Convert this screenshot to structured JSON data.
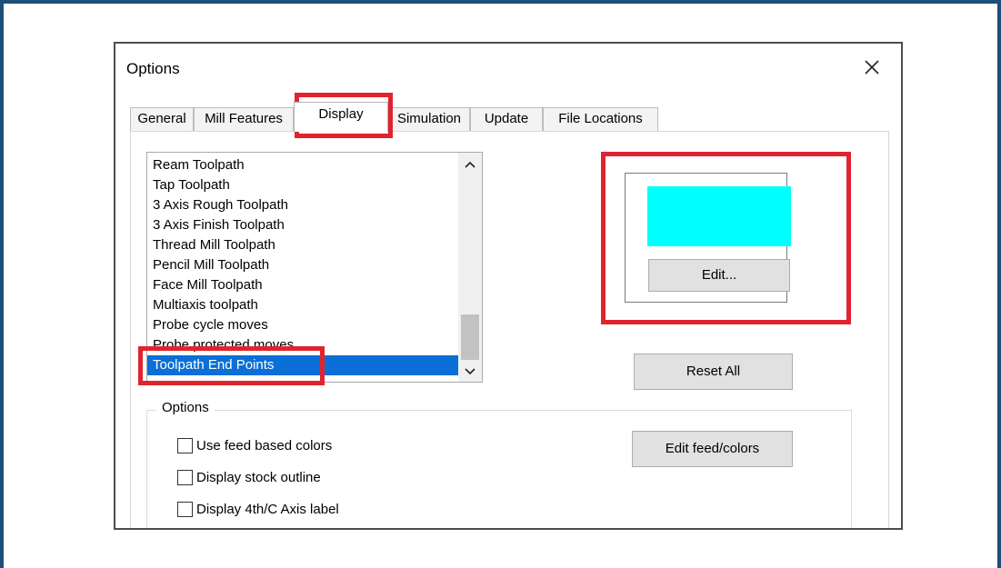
{
  "dialog": {
    "title": "Options",
    "close_glyph": "×"
  },
  "tabs": [
    {
      "label": "General"
    },
    {
      "label": "Mill Features"
    },
    {
      "label": "Display",
      "active": true
    },
    {
      "label": "Simulation"
    },
    {
      "label": "Update"
    },
    {
      "label": "File Locations"
    }
  ],
  "list": {
    "items": [
      "Ream Toolpath",
      "Tap Toolpath",
      "3 Axis Rough Toolpath",
      "3 Axis Finish Toolpath",
      "Thread Mill Toolpath",
      "Pencil Mill Toolpath",
      "Face Mill Toolpath",
      "Multiaxis toolpath",
      "Probe cycle moves",
      "Probe protected moves",
      "Toolpath End Points"
    ],
    "selected_index": 10,
    "scroll_up_glyph": "⌃",
    "scroll_down_glyph": "⌄"
  },
  "color": {
    "swatch_color": "#00ffff",
    "edit_label": "Edit..."
  },
  "reset_all_label": "Reset All",
  "options": {
    "group_label": "Options",
    "checkboxes": [
      {
        "label": "Use feed based colors",
        "checked": false
      },
      {
        "label": "Display stock outline",
        "checked": false
      },
      {
        "label": "Display 4th/C Axis label",
        "checked": false
      }
    ],
    "edit_feed_colors_label": "Edit feed/colors"
  },
  "colors": {
    "highlight": "#e0242f",
    "selection": "#0a6fd6",
    "frame": "#1f4e79"
  }
}
